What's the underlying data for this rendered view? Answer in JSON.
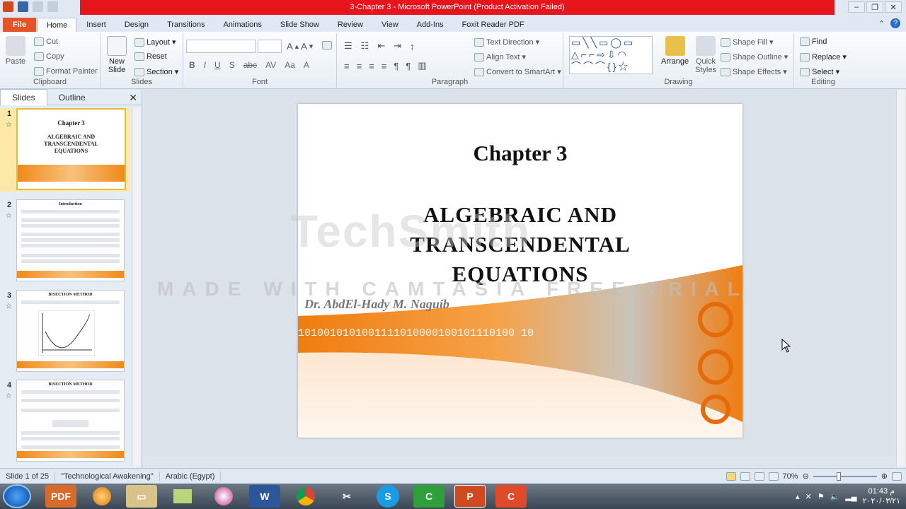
{
  "app": {
    "window_title": "3-Chapter 3  -  Microsoft PowerPoint (Product Activation Failed)"
  },
  "tabs": [
    "File",
    "Home",
    "Insert",
    "Design",
    "Transitions",
    "Animations",
    "Slide Show",
    "Review",
    "View",
    "Add-Ins",
    "Foxit Reader PDF"
  ],
  "ribbon": {
    "clipboard": {
      "label": "Clipboard",
      "paste": "Paste",
      "cut": "Cut",
      "copy": "Copy",
      "format_painter": "Format Painter"
    },
    "slides": {
      "label": "Slides",
      "new_slide": "New Slide",
      "layout": "Layout",
      "reset": "Reset",
      "section": "Section"
    },
    "font": {
      "label": "Font"
    },
    "paragraph": {
      "label": "Paragraph",
      "text_direction": "Text Direction",
      "align_text": "Align Text",
      "convert_smartart": "Convert to SmartArt"
    },
    "drawing": {
      "label": "Drawing",
      "arrange": "Arrange",
      "quick_styles": "Quick Styles",
      "shape_fill": "Shape Fill",
      "shape_outline": "Shape Outline",
      "shape_effects": "Shape Effects"
    },
    "editing": {
      "label": "Editing",
      "find": "Find",
      "replace": "Replace",
      "select": "Select"
    }
  },
  "pane": {
    "tab_slides": "Slides",
    "tab_outline": "Outline",
    "thumbs": [
      {
        "num": "1",
        "title": "Chapter 3",
        "sub": "ALGEBRAIC AND TRANSCENDENTAL EQUATIONS"
      },
      {
        "num": "2",
        "title": "Introduction"
      },
      {
        "num": "3",
        "title": "BISECTION METHOD"
      },
      {
        "num": "4",
        "title": "BISECTION METHOD"
      }
    ]
  },
  "slide": {
    "chapter": "Chapter 3",
    "title_l1": "ALGEBRAIC AND",
    "title_l2": "TRANSCENDENTAL",
    "title_l3": "EQUATIONS",
    "author": "Dr. AbdEl-Hady  M. Naguib",
    "binary": "1010010101001111010000100101110100 10"
  },
  "watermark": {
    "brand": "TechSmith",
    "trial": "MADE WITH CAMTASIA FREE TRIAL"
  },
  "status": {
    "slide_of": "Slide 1 of 25",
    "theme": "\"Technological Awakening\"",
    "language": "Arabic (Egypt)",
    "zoom": "70%"
  },
  "tray": {
    "time": "01:43 م",
    "date": "٢٠٢٠/٠٣/٢١"
  },
  "colors": {
    "title_red": "#e8141b",
    "file_tab": "#e4532a",
    "accent_orange": "#f08a1a"
  }
}
